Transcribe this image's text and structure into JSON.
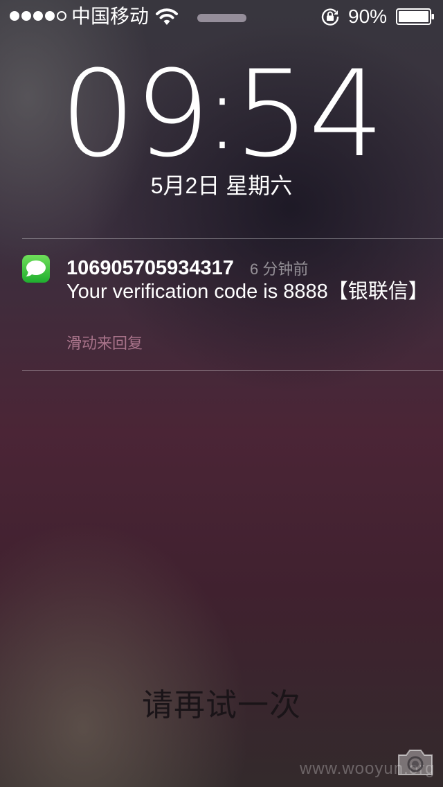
{
  "status_bar": {
    "signal_strength": 4,
    "signal_max": 5,
    "carrier": "中国移动",
    "wifi_icon": "wifi-icon",
    "rotation_lock_icon": "rotation-lock-icon",
    "battery_percent": "90%",
    "battery_icon": "battery-icon"
  },
  "lock_screen": {
    "clock_hours": "09",
    "clock_separator": ":",
    "clock_minutes": "54",
    "date": "5月2日 星期六"
  },
  "notification": {
    "app_icon": "messages-icon",
    "sender": "106905705934317",
    "time_ago": "6 分钟前",
    "body": "Your verification code is 8888【银联信】",
    "reply_hint": "滑动来回复"
  },
  "bottom": {
    "retry_text": "请再试一次",
    "watermark": "www.wooyun.org",
    "camera_icon": "camera-icon"
  },
  "colors": {
    "text": "#ffffff",
    "reply_hint": "#a8738a",
    "messages_green": "#34c749"
  }
}
